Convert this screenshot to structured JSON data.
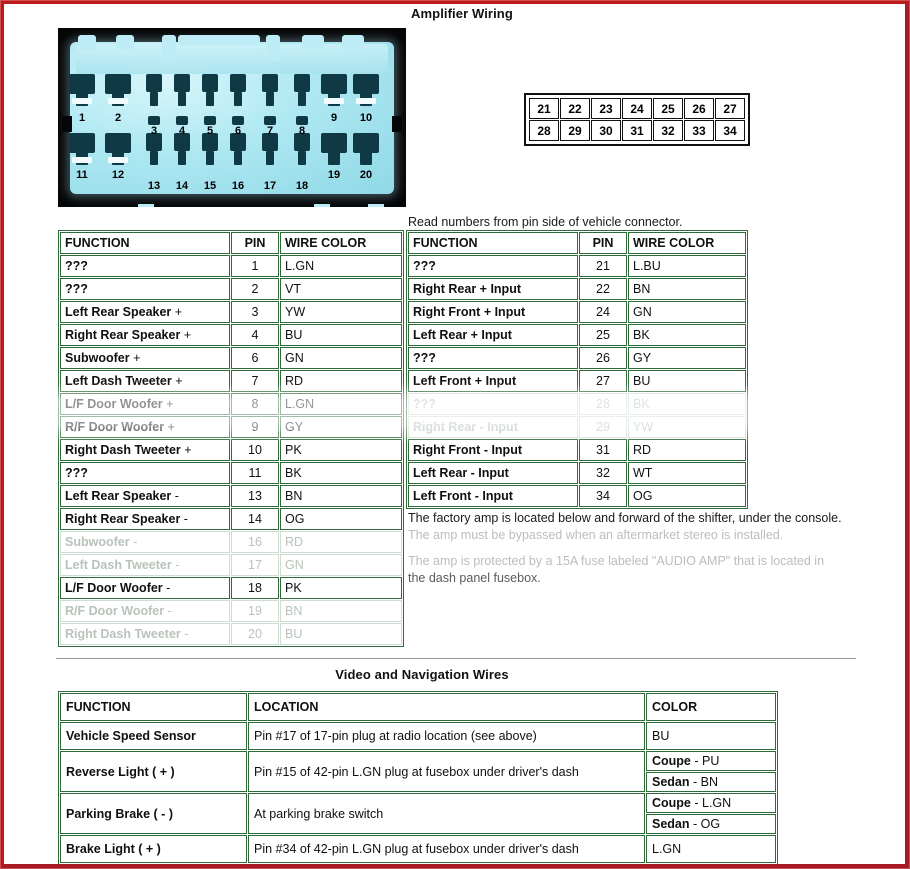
{
  "page": {
    "frame_color": "#c0191c",
    "table_border_color": "#2f6b3a"
  },
  "amplifier": {
    "title": "Amplifier Wiring",
    "read_note": "Read numbers from pin side of vehicle connector.",
    "connector": {
      "top_row_pins": [
        "1",
        "2",
        "3",
        "4",
        "5",
        "6",
        "7",
        "8",
        "9",
        "10"
      ],
      "bottom_row_pins": [
        "11",
        "12",
        "13",
        "14",
        "15",
        "16",
        "17",
        "18",
        "19",
        "20"
      ]
    },
    "pin_grid": {
      "row1": [
        "21",
        "22",
        "23",
        "24",
        "25",
        "26",
        "27"
      ],
      "row2": [
        "28",
        "29",
        "30",
        "31",
        "32",
        "33",
        "34"
      ]
    },
    "left_table": {
      "headers": [
        "FUNCTION",
        "PIN",
        "WIRE COLOR"
      ],
      "rows": [
        {
          "function": "???",
          "pin": "1",
          "color": "L.GN",
          "faded": false
        },
        {
          "function": "???",
          "pin": "2",
          "color": "VT",
          "faded": false
        },
        {
          "function": "Left Rear Speaker +",
          "pin": "3",
          "color": "YW",
          "faded": false
        },
        {
          "function": "Right Rear Speaker +",
          "pin": "4",
          "color": "BU",
          "faded": false
        },
        {
          "function": "Subwoofer +",
          "pin": "6",
          "color": "GN",
          "faded": false
        },
        {
          "function": "Left Dash Tweeter +",
          "pin": "7",
          "color": "RD",
          "faded": false
        },
        {
          "function": "L/F Door Woofer +",
          "pin": "8",
          "color": "L.GN",
          "faded": false
        },
        {
          "function": "R/F Door Woofer +",
          "pin": "9",
          "color": "GY",
          "faded": false
        },
        {
          "function": "Right Dash Tweeter +",
          "pin": "10",
          "color": "PK",
          "faded": false
        },
        {
          "function": "???",
          "pin": "11",
          "color": "BK",
          "faded": false
        },
        {
          "function": "Left Rear Speaker -",
          "pin": "13",
          "color": "BN",
          "faded": false
        },
        {
          "function": "Right Rear Speaker -",
          "pin": "14",
          "color": "OG",
          "faded": false
        },
        {
          "function": "Subwoofer -",
          "pin": "16",
          "color": "RD",
          "faded": true
        },
        {
          "function": "Left Dash Tweeter -",
          "pin": "17",
          "color": "GN",
          "faded": true
        },
        {
          "function": "L/F Door Woofer -",
          "pin": "18",
          "color": "PK",
          "faded": false
        },
        {
          "function": "R/F Door Woofer -",
          "pin": "19",
          "color": "BN",
          "faded": true
        },
        {
          "function": "Right Dash Tweeter -",
          "pin": "20",
          "color": "BU",
          "faded": true
        }
      ]
    },
    "right_table": {
      "headers": [
        "FUNCTION",
        "PIN",
        "WIRE COLOR"
      ],
      "rows": [
        {
          "function": "???",
          "pin": "21",
          "color": "L.BU",
          "faded": false
        },
        {
          "function": "Right Rear + Input",
          "pin": "22",
          "color": "BN",
          "faded": false
        },
        {
          "function": "Right Front + Input",
          "pin": "24",
          "color": "GN",
          "faded": false
        },
        {
          "function": "Left Rear + Input",
          "pin": "25",
          "color": "BK",
          "faded": false
        },
        {
          "function": "???",
          "pin": "26",
          "color": "GY",
          "faded": false
        },
        {
          "function": "Left Front + Input",
          "pin": "27",
          "color": "BU",
          "faded": false
        },
        {
          "function": "???",
          "pin": "28",
          "color": "BK",
          "faded": true
        },
        {
          "function": "Right Rear - Input",
          "pin": "29",
          "color": "YW",
          "faded": true
        },
        {
          "function": "Right Front - Input",
          "pin": "31",
          "color": "RD",
          "faded": false
        },
        {
          "function": "Left Rear - Input",
          "pin": "32",
          "color": "WT",
          "faded": false
        },
        {
          "function": "Left Front - Input",
          "pin": "34",
          "color": "OG",
          "faded": false
        }
      ]
    },
    "notes": {
      "note1_line1": "The factory amp is located below and forward of the shifter, under the console.",
      "note1_line2": "The amp must be bypassed when an aftermarket stereo is installed.",
      "note2_line1": "The amp is protected by a 15A fuse labeled \"AUDIO AMP\" that is located in",
      "note2_line2": "the dash panel fusebox."
    }
  },
  "video": {
    "title": "Video and Navigation Wires",
    "headers": [
      "FUNCTION",
      "LOCATION",
      "COLOR"
    ],
    "rows": [
      {
        "function": "Vehicle Speed Sensor",
        "location": "Pin #17 of 17-pin plug at radio location (see above)",
        "colors": [
          {
            "label": "",
            "value": "BU"
          }
        ]
      },
      {
        "function": "Reverse Light ( + )",
        "location": "Pin #15 of 42-pin L.GN plug at fusebox under driver's dash",
        "colors": [
          {
            "label": "Coupe",
            "value": "- PU"
          },
          {
            "label": "Sedan",
            "value": "- BN"
          }
        ]
      },
      {
        "function": "Parking Brake ( - )",
        "location": "At parking brake switch",
        "colors": [
          {
            "label": "Coupe",
            "value": "- L.GN"
          },
          {
            "label": "Sedan",
            "value": "- OG"
          }
        ]
      },
      {
        "function": "Brake Light ( + )",
        "location": "Pin #34 of 42-pin L.GN plug at fusebox under driver's dash",
        "colors": [
          {
            "label": "",
            "value": "L.GN"
          }
        ]
      }
    ]
  }
}
